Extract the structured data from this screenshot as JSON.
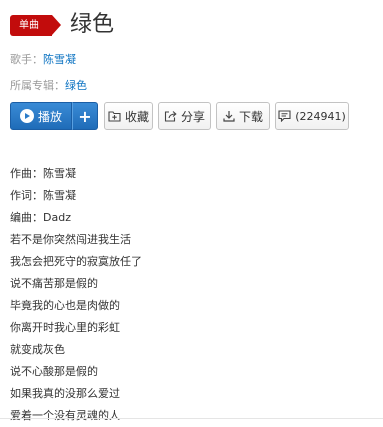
{
  "song": {
    "badge": "单曲",
    "title": "绿色"
  },
  "meta": {
    "singer_label": "歌手：",
    "singer": "陈雪凝",
    "album_label": "所属专辑：",
    "album": "绿色"
  },
  "toolbar": {
    "play_label": "播放",
    "add_label": "+",
    "favorite_label": "收藏",
    "share_label": "分享",
    "download_label": "下载",
    "comment_count": "(224941)"
  },
  "colors": {
    "brand_red": "#c20c0c",
    "link_blue": "#0c73c2",
    "play_blue": "#2b7bc8"
  },
  "lyrics": [
    "作曲：陈雪凝",
    "作词：陈雪凝",
    "编曲：Dadz",
    "若不是你突然闯进我生活",
    "我怎会把死守的寂寞放任了",
    "说不痛苦那是假的",
    "毕竟我的心也是肉做的",
    "你离开时我心里的彩虹",
    "就变成灰色",
    "说不心酸那是假的",
    "如果我真的没那么爱过",
    "爱着一个没有灵魂的人"
  ]
}
